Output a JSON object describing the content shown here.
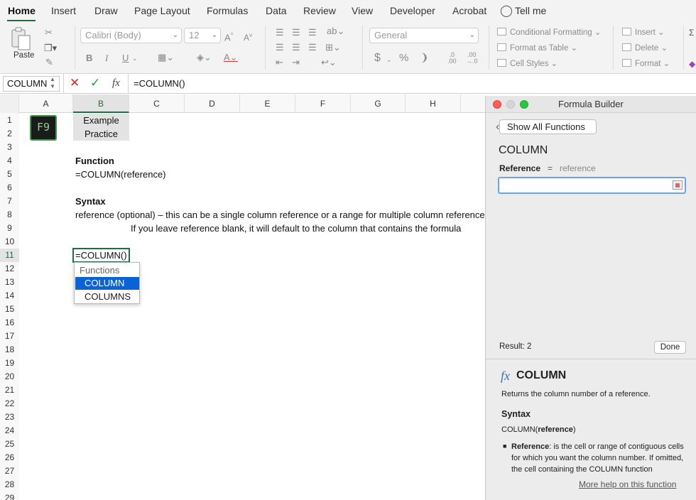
{
  "ribbon": {
    "tabs": [
      "Home",
      "Insert",
      "Draw",
      "Page Layout",
      "Formulas",
      "Data",
      "Review",
      "View",
      "Developer",
      "Acrobat"
    ],
    "active_tab": "Home",
    "tell_me": "Tell me",
    "paste_label": "Paste",
    "font_name": "Calibri (Body)",
    "font_size": "12",
    "number_format": "General",
    "conditional_formatting": "Conditional Formatting",
    "format_as_table": "Format as Table",
    "cell_styles": "Cell Styles",
    "insert": "Insert",
    "delete": "Delete",
    "format": "Format",
    "accent_color": "#1d6f42"
  },
  "formula_bar": {
    "name_box": "COLUMN",
    "fx_label": "fx",
    "formula": "=COLUMN()"
  },
  "sheet": {
    "columns": [
      "A",
      "B",
      "C",
      "D",
      "E",
      "F",
      "G",
      "H"
    ],
    "rows": [
      "1",
      "2",
      "3",
      "4",
      "5",
      "6",
      "7",
      "8",
      "9",
      "10",
      "11",
      "12",
      "13",
      "14",
      "15",
      "16",
      "17",
      "18",
      "19",
      "20",
      "21",
      "22",
      "23",
      "24",
      "25",
      "26",
      "27",
      "28",
      "29"
    ],
    "logo_text": "F9",
    "b1": "Example",
    "b2": "Practice",
    "b4": "Function",
    "b5": "=COLUMN(reference)",
    "b7": "Syntax",
    "b8": "reference (optional) – this can be a single column reference or a range for multiple column references",
    "c9": "If you leave reference blank, it will default to the column that contains the formula",
    "b11": "=COLUMN()"
  },
  "autocomplete": {
    "header": "Functions",
    "items": [
      "COLUMN",
      "COLUMNS"
    ],
    "selected": "COLUMN"
  },
  "formula_builder": {
    "title": "Formula Builder",
    "show_all": "Show All Functions",
    "function_name": "COLUMN",
    "arg_label": "Reference",
    "arg_eq": "=",
    "arg_hint": "reference",
    "arg_value": "",
    "result": "Result: 2",
    "done": "Done",
    "help_fx": "fx",
    "help_title": "COLUMN",
    "help_desc": "Returns the column number of a reference.",
    "syntax_heading": "Syntax",
    "syntax_fn": "COLUMN(",
    "syntax_arg": "reference",
    "syntax_close": ")",
    "bullet_term": "Reference",
    "bullet_text": ": is the cell or range of contiguous cells for which you want the column number. If omitted, the cell containing the COLUMN function",
    "more_help": "More help on this function"
  }
}
